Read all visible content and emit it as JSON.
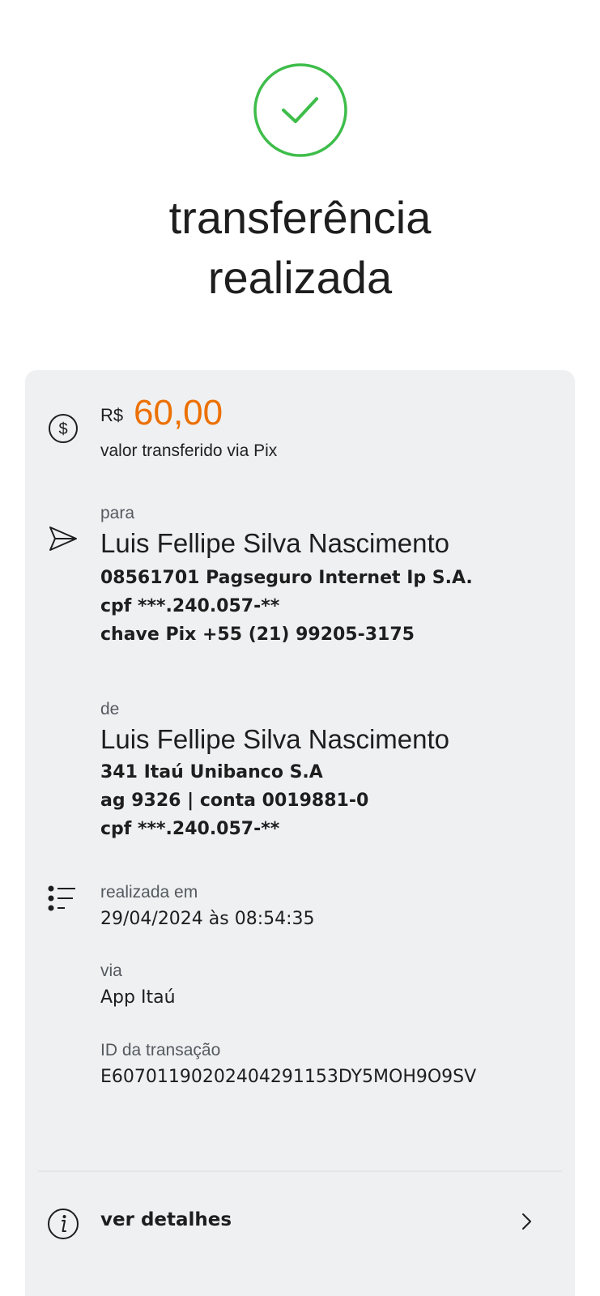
{
  "header": {
    "title_line1": "transferência",
    "title_line2": "realizada",
    "status_icon": "check-circle-icon",
    "accent_color": "#3ebd4a"
  },
  "amount": {
    "currency": "R$",
    "value": "60,00",
    "caption": "valor transferido via Pix",
    "color": "#ec7000",
    "icon": "dollar-coin-icon"
  },
  "recipient": {
    "label": "para",
    "name": "Luis Fellipe Silva Nascimento",
    "bank": "08561701 Pagseguro Internet Ip S.A.",
    "cpf": "cpf ***.240.057-**",
    "pix_key": "chave Pix +55 (21) 99205-3175",
    "icon": "send-icon"
  },
  "sender": {
    "label": "de",
    "name": "Luis Fellipe Silva Nascimento",
    "bank": "341 Itaú Unibanco S.A",
    "account": "ag 9326 | conta 0019881-0",
    "cpf": "cpf ***.240.057-**"
  },
  "info": {
    "icon": "list-icon",
    "date_label": "realizada em",
    "date_value": "29/04/2024 às 08:54:35",
    "via_label": "via",
    "via_value": "App Itaú",
    "id_label": "ID da transação",
    "id_value": "E60701190202404291153DY5MOH9O9SV"
  },
  "details": {
    "label": "ver detalhes",
    "icon": "info-icon",
    "arrow_icon": "chevron-right-icon"
  }
}
